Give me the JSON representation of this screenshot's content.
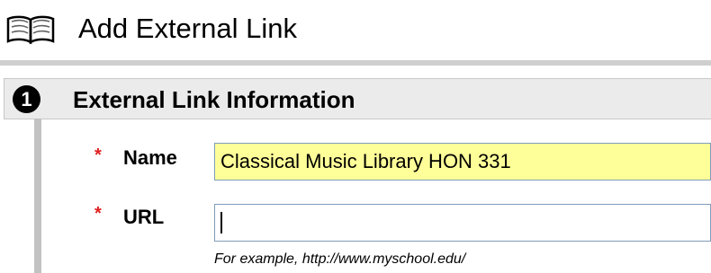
{
  "header": {
    "title": "Add External Link",
    "icon": "book-icon"
  },
  "section": {
    "step_number": "1",
    "title": "External Link Information"
  },
  "form": {
    "name": {
      "label": "Name",
      "required_marker": "*",
      "value": "Classical Music Library HON 331",
      "highlight_color": "#ffff99"
    },
    "url": {
      "label": "URL",
      "required_marker": "*",
      "value": "",
      "help_text": "For example, http://www.myschool.edu/"
    }
  },
  "colors": {
    "required": "#e02020",
    "section_background": "#ebebeb",
    "input_border": "#7f9db9"
  }
}
